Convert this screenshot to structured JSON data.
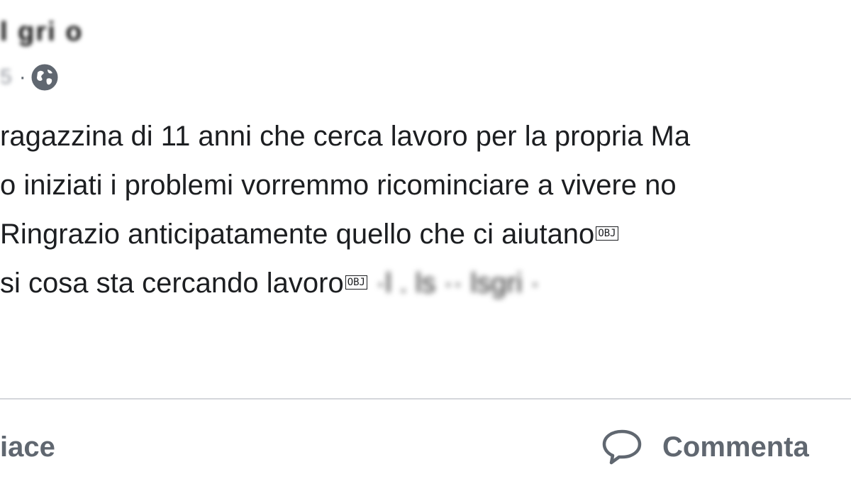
{
  "post": {
    "author_name": "l gri o",
    "timestamp": "5",
    "separator": "·",
    "privacy_icon": "globe-icon",
    "lines": [
      "ragazzina di 11 anni che cerca lavoro per la propria Ma",
      "o iniziati i problemi vorremmo ricominciare a vivere no",
      "Ringrazio anticipatamente quello che ci aiutano",
      "si cosa sta cercando lavoro"
    ],
    "obj_marker": "OBJ",
    "obscured_tail": "·l . ls ·· lsgri ·"
  },
  "actions": {
    "like_label": "iace",
    "comment_label": "Commenta",
    "comment_icon": "comment-bubble-icon"
  },
  "colors": {
    "text": "#1c1e21",
    "secondary": "#606770",
    "divider": "#d5d7db",
    "background": "#ffffff"
  }
}
